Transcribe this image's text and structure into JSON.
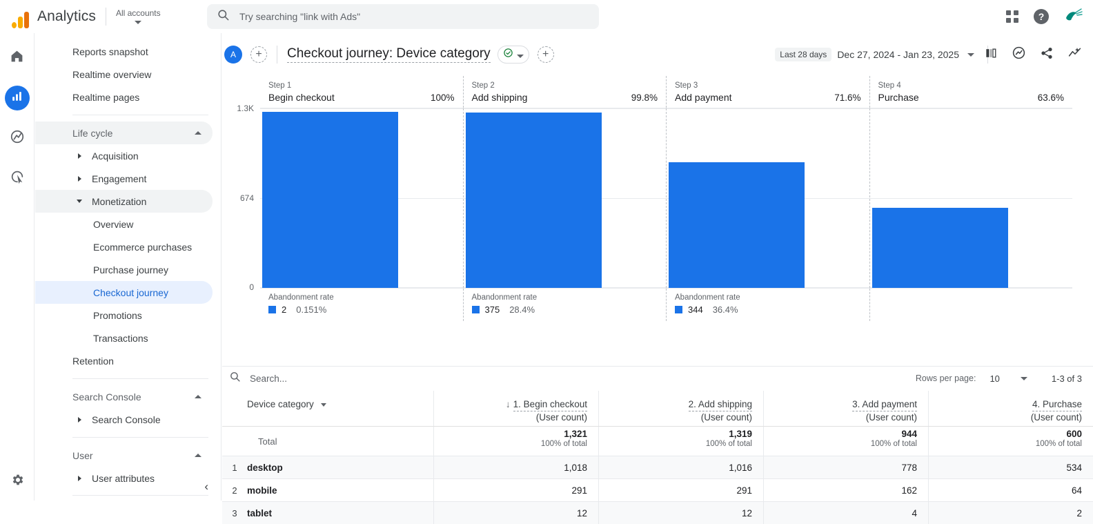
{
  "topbar": {
    "brand": "Analytics",
    "account_selector": "All accounts",
    "search_placeholder": "Try searching \"link with Ads\"",
    "search_value": "",
    "icons": {
      "search": "search-icon",
      "apps": "apps-grid-icon",
      "help": "help-icon",
      "avatar": "hummingbird-avatar"
    }
  },
  "rail": {
    "items": [
      {
        "name": "home",
        "icon": "home-icon"
      },
      {
        "name": "reports",
        "icon": "bar-chart-icon",
        "active": true
      },
      {
        "name": "explore",
        "icon": "explore-compass-icon"
      },
      {
        "name": "advertising",
        "icon": "advertising-click-icon"
      }
    ],
    "settings": {
      "name": "admin",
      "icon": "gear-icon"
    }
  },
  "sidenav": {
    "top_links": [
      "Reports snapshot",
      "Realtime overview",
      "Realtime pages"
    ],
    "groups": [
      {
        "label": "Life cycle",
        "items": [
          {
            "label": "Acquisition",
            "expandable": true,
            "expanded": false
          },
          {
            "label": "Engagement",
            "expandable": true,
            "expanded": false
          },
          {
            "label": "Monetization",
            "expandable": true,
            "expanded": true,
            "highlighted": true
          },
          {
            "label": "Overview",
            "sub": true
          },
          {
            "label": "Ecommerce purchases",
            "sub": true
          },
          {
            "label": "Purchase journey",
            "sub": true
          },
          {
            "label": "Checkout journey",
            "sub": true,
            "selected": true
          },
          {
            "label": "Promotions",
            "sub": true
          },
          {
            "label": "Transactions",
            "sub": true
          },
          {
            "label": "Retention",
            "expandable": false
          }
        ]
      },
      {
        "label": "Search Console",
        "items": [
          {
            "label": "Search Console",
            "expandable": true,
            "expanded": false
          }
        ]
      },
      {
        "label": "User",
        "items": [
          {
            "label": "User attributes",
            "expandable": true,
            "expanded": false
          }
        ]
      }
    ],
    "collapse_label": "‹"
  },
  "pagehead": {
    "avatar_initial": "A",
    "add_comparison_label": "+",
    "title": "Checkout journey: Device category",
    "check_icon": "verified-check-icon",
    "add_label": "+",
    "date_chip": "Last 28 days",
    "date_range": "Dec 27, 2024 - Jan 23, 2025",
    "icons": [
      "compare-bars-icon",
      "insights-icon",
      "share-icon",
      "trends-icon"
    ]
  },
  "chart_data": {
    "type": "bar",
    "title": "Checkout journey: Device category",
    "categories": [
      "Begin checkout",
      "Add shipping",
      "Add payment",
      "Purchase"
    ],
    "step_labels": [
      "Step 1",
      "Step 2",
      "Step 3",
      "Step 4"
    ],
    "values": [
      1321,
      1319,
      944,
      600
    ],
    "completion_rates": [
      "100%",
      "99.8%",
      "71.6%",
      "63.6%"
    ],
    "abandonment": [
      {
        "label": "Abandonment rate",
        "count": "2",
        "rate": "0.151%"
      },
      {
        "label": "Abandonment rate",
        "count": "375",
        "rate": "28.4%"
      },
      {
        "label": "Abandonment rate",
        "count": "344",
        "rate": "36.4%"
      },
      {
        "label": "",
        "count": "",
        "rate": ""
      }
    ],
    "yticks": [
      "1.3K",
      "674",
      "0"
    ],
    "ylim": [
      0,
      1348
    ],
    "ylabel": "",
    "xlabel": "",
    "grid": true,
    "legend": "none",
    "series_color": "#1a73e8"
  },
  "table_toolbar": {
    "search_placeholder": "Search...",
    "search_value": "",
    "rows_per_page_label": "Rows per page:",
    "rows_per_page_value": "10",
    "range_label": "1-3 of 3"
  },
  "table": {
    "dimension_header": "Device category",
    "metric_headers": [
      {
        "line1": "1. Begin checkout",
        "line2": "(User count)",
        "sorted": true
      },
      {
        "line1": "2. Add shipping",
        "line2": "(User count)",
        "sorted": false
      },
      {
        "line1": "3. Add payment",
        "line2": "(User count)",
        "sorted": false
      },
      {
        "line1": "4. Purchase",
        "line2": "(User count)",
        "sorted": false
      }
    ],
    "total_label": "Total",
    "totals": [
      {
        "value": "1,321",
        "sub": "100% of total"
      },
      {
        "value": "1,319",
        "sub": "100% of total"
      },
      {
        "value": "944",
        "sub": "100% of total"
      },
      {
        "value": "600",
        "sub": "100% of total"
      }
    ],
    "rows": [
      {
        "index": "1",
        "dimension": "desktop",
        "values": [
          "1,018",
          "1,016",
          "778",
          "534"
        ]
      },
      {
        "index": "2",
        "dimension": "mobile",
        "values": [
          "291",
          "291",
          "162",
          "64"
        ]
      },
      {
        "index": "3",
        "dimension": "tablet",
        "values": [
          "12",
          "12",
          "4",
          "2"
        ]
      }
    ]
  },
  "colors": {
    "accent": "#1a73e8",
    "brand_orange": "#f9ab00",
    "selected_bg": "#e8f0fe",
    "text": "#202124"
  }
}
